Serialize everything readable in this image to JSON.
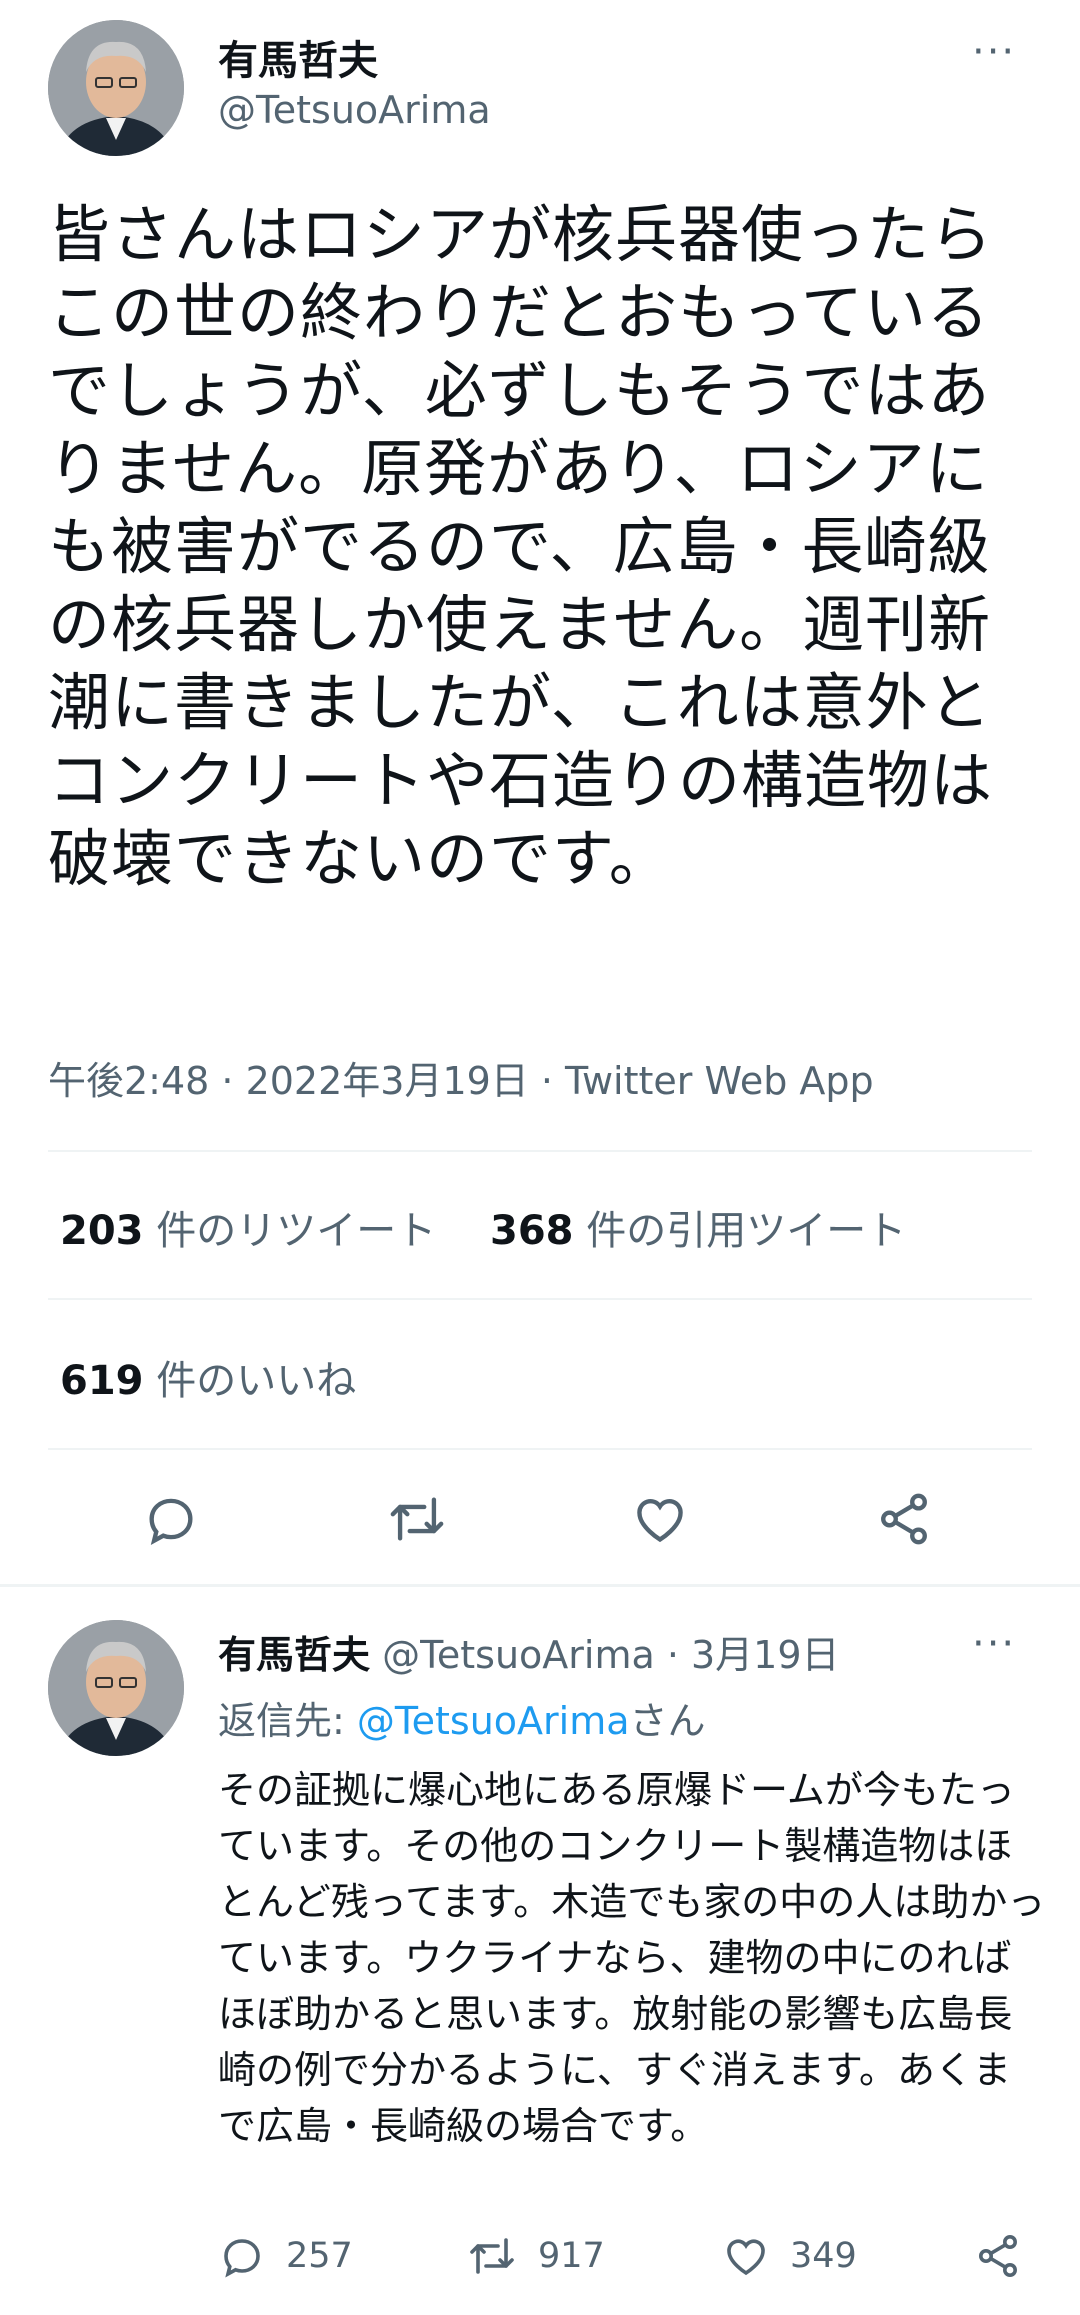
{
  "tweet": {
    "display_name": "有馬哲夫",
    "handle": "@TetsuoArima",
    "more": "···",
    "text": "皆さんはロシアが核兵器使ったらこの世の終わりだとおもっているでしょうが、必ずしもそうではありません。原発があり、ロシアにも被害がでるので、広島・長崎級の核兵器しか使えません。週刊新潮に書きましたが、これは意外とコンクリートや石造りの構造物は破壊できないのです。",
    "meta": "午後2:48 · 2022年3月19日 · Twitter Web App",
    "retweets_count": "203",
    "retweets_label": " 件のリツイート",
    "quotes_count": "368",
    "quotes_label": " 件の引用ツイート",
    "likes_count": "619",
    "likes_label": " 件のいいね",
    "actions": [
      "reply-icon",
      "retweet-icon",
      "like-icon",
      "share-icon"
    ]
  },
  "reply": {
    "display_name": "有馬哲夫",
    "handle": "@TetsuoArima",
    "date": " · 3月19日",
    "more": "···",
    "replying_prefix": "返信先: ",
    "replying_handle": "@TetsuoArima",
    "replying_suffix": "さん",
    "text": "その証拠に爆心地にある原爆ドームが今もたっています。その他のコンクリート製構造物はほとんど残ってます。木造でも家の中の人は助かっています。ウクライナなら、建物の中にのればほぼ助かると思います。放射能の影響も広島長崎の例で分かるように、すぐ消えます。あくまで広島・長崎級の場合です。",
    "reply_count": "257",
    "retweet_count": "917",
    "like_count": "349"
  },
  "colors": {
    "text": "#0f1419",
    "secondary": "#536471",
    "link": "#1d9bf0",
    "divider": "#eff3f4"
  }
}
